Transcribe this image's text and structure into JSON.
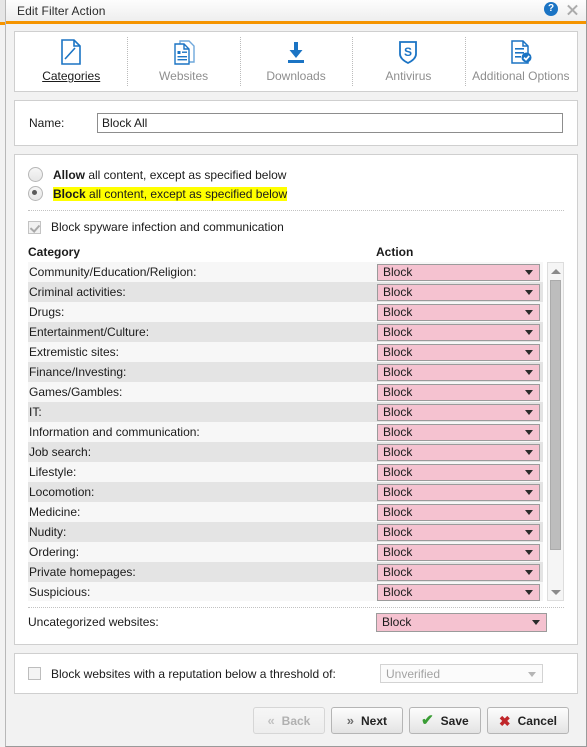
{
  "window": {
    "title": "Edit Filter Action",
    "help_icon": "help-icon",
    "close_icon": "close-icon"
  },
  "tabs": [
    {
      "label": "Categories",
      "icon": "page-pencil-icon",
      "active": true
    },
    {
      "label": "Websites",
      "icon": "documents-icon",
      "active": false
    },
    {
      "label": "Downloads",
      "icon": "download-arrow-icon",
      "active": false
    },
    {
      "label": "Antivirus",
      "icon": "shield-s-icon",
      "active": false
    },
    {
      "label": "Additional Options",
      "icon": "document-check-icon",
      "active": false
    }
  ],
  "name_field": {
    "label": "Name:",
    "value": "Block All",
    "placeholder": ""
  },
  "mode_options": {
    "allow": {
      "bold": "Allow",
      "rest": " all content, except as specified below",
      "selected": false
    },
    "block": {
      "bold": "Block",
      "rest": " all content, except as specified below",
      "selected": true
    }
  },
  "spyware": {
    "label": "Block spyware infection and communication",
    "checked": true,
    "disabled": true
  },
  "table": {
    "col_category": "Category",
    "col_action": "Action",
    "rows": [
      {
        "category": "Community/Education/Religion:",
        "action": "Block"
      },
      {
        "category": "Criminal activities:",
        "action": "Block"
      },
      {
        "category": "Drugs:",
        "action": "Block"
      },
      {
        "category": "Entertainment/Culture:",
        "action": "Block"
      },
      {
        "category": "Extremistic sites:",
        "action": "Block"
      },
      {
        "category": "Finance/Investing:",
        "action": "Block"
      },
      {
        "category": "Games/Gambles:",
        "action": "Block"
      },
      {
        "category": "IT:",
        "action": "Block"
      },
      {
        "category": "Information and communication:",
        "action": "Block"
      },
      {
        "category": "Job search:",
        "action": "Block"
      },
      {
        "category": "Lifestyle:",
        "action": "Block"
      },
      {
        "category": "Locomotion:",
        "action": "Block"
      },
      {
        "category": "Medicine:",
        "action": "Block"
      },
      {
        "category": "Nudity:",
        "action": "Block"
      },
      {
        "category": "Ordering:",
        "action": "Block"
      },
      {
        "category": "Private homepages:",
        "action": "Block"
      },
      {
        "category": "Suspicious:",
        "action": "Block"
      }
    ]
  },
  "uncategorized": {
    "label": "Uncategorized websites:",
    "action": "Block"
  },
  "reputation": {
    "label": "Block websites with a reputation below a threshold of:",
    "checked": false,
    "value": "Unverified"
  },
  "footer": {
    "back": "Back",
    "next": "Next",
    "save": "Save",
    "cancel": "Cancel"
  },
  "colors": {
    "accent_orange": "#f59400",
    "block_pink": "#f5c2d0",
    "highlight_yellow": "#ffff00",
    "save_green": "#3a9d35",
    "cancel_red": "#c0262a",
    "icon_blue": "#1b74c4"
  }
}
